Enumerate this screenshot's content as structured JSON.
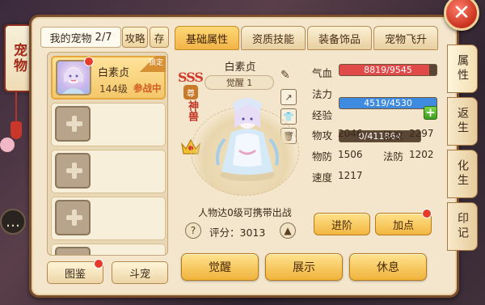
{
  "lantern": {
    "title": "宠物"
  },
  "list_header": {
    "label": "我的宠物",
    "count": "2/7"
  },
  "header_buttons": {
    "strategy": "攻略",
    "store": "存"
  },
  "pets": [
    {
      "name": "白素贞",
      "level": "144级",
      "status": "参战中",
      "tag": "锁定",
      "selected": true
    }
  ],
  "empty_slots": 4,
  "bottom_buttons": {
    "catalog": "图鉴",
    "battle": "斗宠"
  },
  "tabs": [
    {
      "label": "基础属性",
      "active": true
    },
    {
      "label": "资质技能",
      "active": false
    },
    {
      "label": "装备饰品",
      "active": false
    },
    {
      "label": "宠物飞升",
      "active": false
    }
  ],
  "pet_detail": {
    "name": "白素贞",
    "awaken": "觉醒 1",
    "grade": "SSS",
    "rank_badge": "尊",
    "type": "神兽",
    "carry_text": "人物达0级可携带出战",
    "score_label": "评分：",
    "score": "3013"
  },
  "bars": {
    "hp": {
      "label": "气血",
      "text": "8819/9545",
      "ratio": 0.924,
      "color": "#e04a48"
    },
    "mp": {
      "label": "法力",
      "text": "4519/4530",
      "ratio": 0.997,
      "color": "#3e8be0"
    },
    "exp": {
      "label": "经验",
      "text": "0/411864",
      "ratio": 0,
      "color": "#c9a06a"
    }
  },
  "stats": {
    "phys_atk_label": "物攻",
    "phys_atk": "2046",
    "mag_atk_label": "法攻",
    "mag_atk": "2297",
    "phys_def_label": "物防",
    "phys_def": "1506",
    "mag_def_label": "法防",
    "mag_def": "1202",
    "speed_label": "速度",
    "speed": "1217"
  },
  "action_buttons": {
    "advance": "进阶",
    "add_points": "加点"
  },
  "big_buttons": {
    "awaken": "觉醒",
    "show": "展示",
    "rest": "休息"
  },
  "side_tabs": [
    {
      "label": "属性",
      "active": true
    },
    {
      "label": "返生",
      "active": false
    },
    {
      "label": "化生",
      "active": false
    },
    {
      "label": "印记",
      "active": false
    }
  ]
}
